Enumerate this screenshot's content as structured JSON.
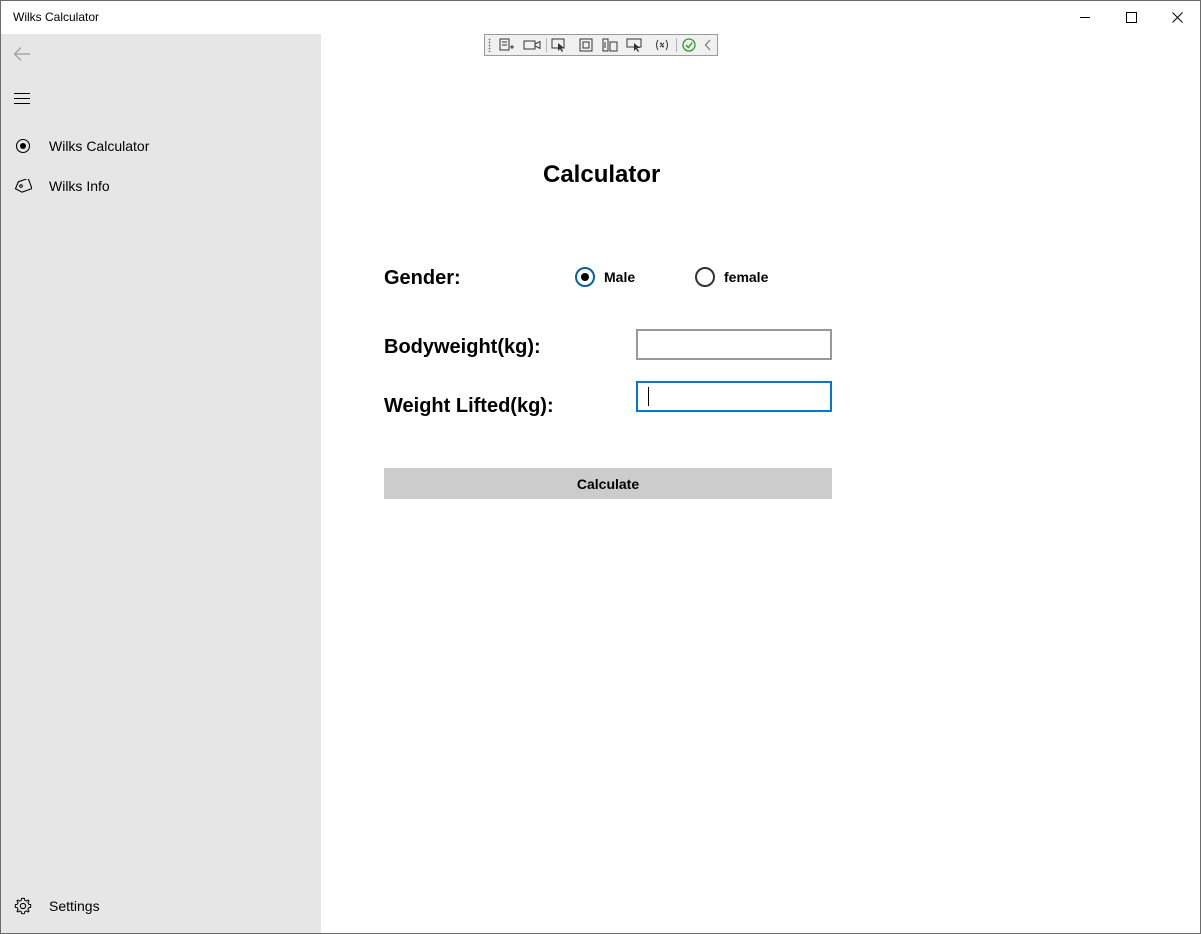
{
  "window": {
    "title": "Wilks Calculator"
  },
  "nav": {
    "items": [
      {
        "label": "Wilks Calculator",
        "icon": "radio-target-icon"
      },
      {
        "label": "Wilks Info",
        "icon": "tag-icon"
      }
    ],
    "settings_label": "Settings"
  },
  "page": {
    "title": "Calculator",
    "gender_label": "Gender:",
    "gender_options": [
      "Male",
      "female"
    ],
    "gender_selected": "Male",
    "bodyweight_label": "Bodyweight(kg):",
    "bodyweight_value": "",
    "weight_lifted_label": "Weight Lifted(kg):",
    "weight_lifted_value": "",
    "calculate_label": "Calculate"
  },
  "colors": {
    "accent": "#0078d7",
    "sidebar_bg": "#e6e6e6",
    "button_bg": "#cccccc"
  }
}
